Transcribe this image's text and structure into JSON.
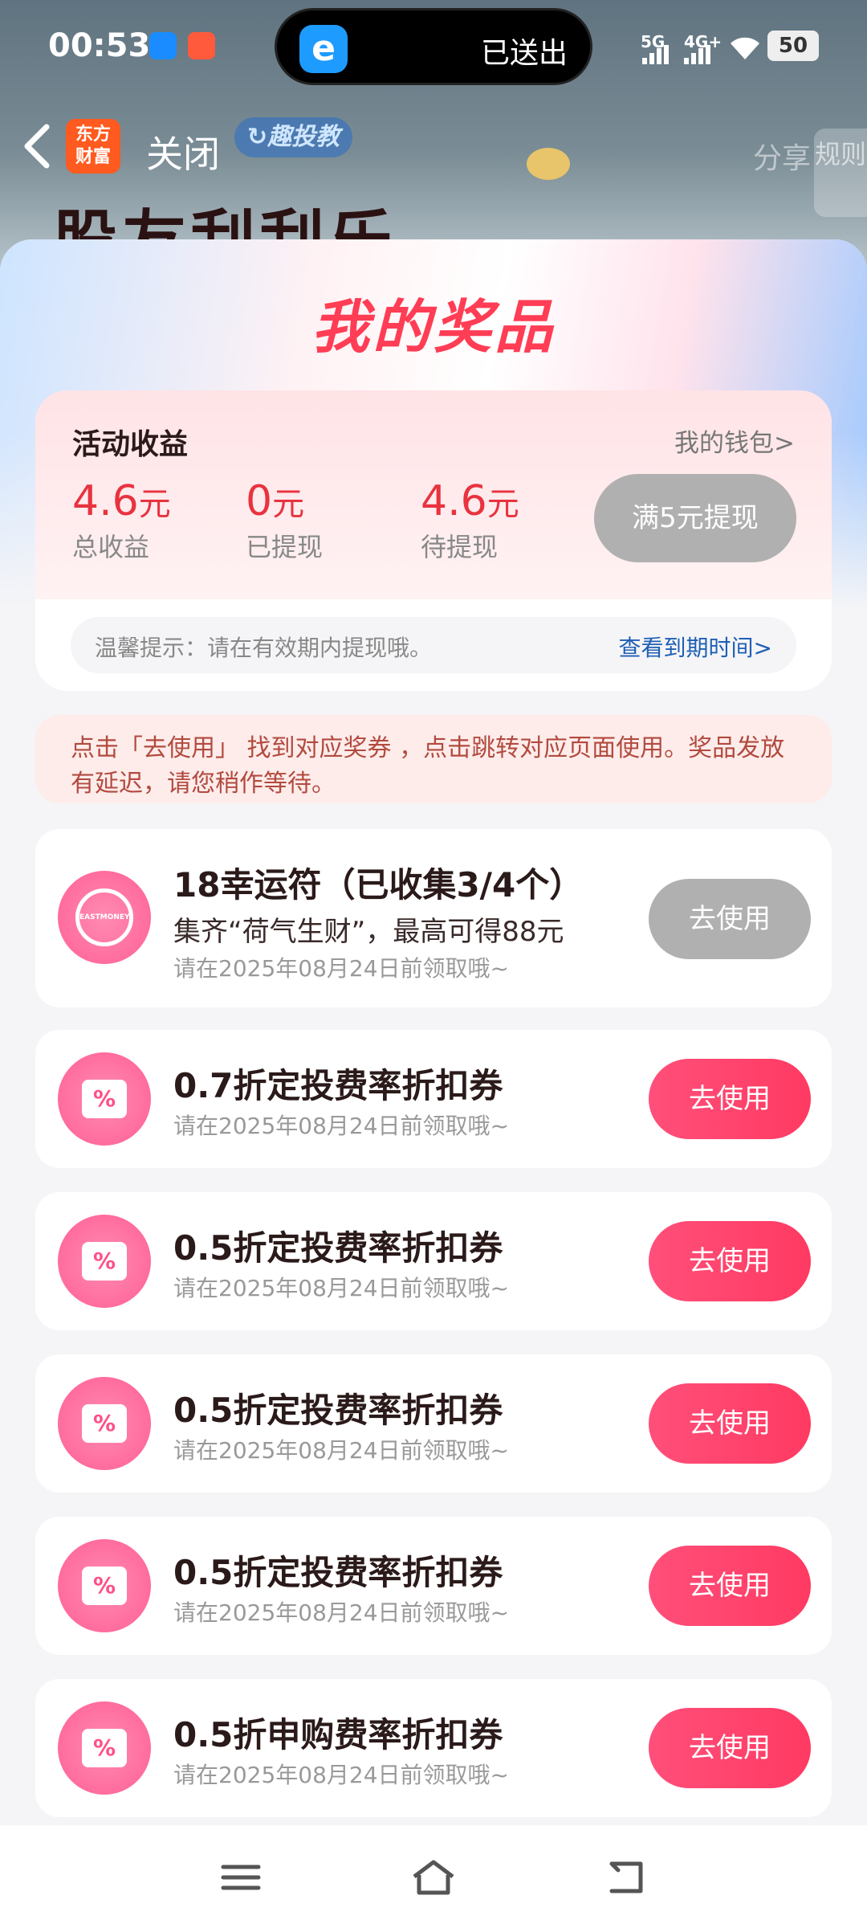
{
  "status_bar": {
    "time": "00:53",
    "island_text": "已送出",
    "island_icon_glyph": "e",
    "signal_1": "5G",
    "signal_2": "4G+",
    "battery": "50"
  },
  "nav": {
    "logo_text_line1": "东方",
    "logo_text_line2": "财富",
    "close_label": "关闭",
    "tag_label": "↻趣投教",
    "banner_text": "股友刮刮乐",
    "share_label": "分享",
    "rules_label": "规则"
  },
  "panel": {
    "title": "我的奖品"
  },
  "earnings": {
    "title": "活动收益",
    "wallet_link": "我的钱包>",
    "stats": [
      {
        "value": "4.6",
        "unit": "元",
        "label": "总收益"
      },
      {
        "value": "0",
        "unit": "元",
        "label": "已提现"
      },
      {
        "value": "4.6",
        "unit": "元",
        "label": "待提现"
      }
    ],
    "withdraw_label": "满5元提现",
    "tip_text": "温馨提示：请在有效期内提现哦。",
    "tip_link": "查看到期时间>"
  },
  "notice": "点击「去使用」 找到对应奖券 ，点击跳转对应页面使用。奖品发放有延迟，请您稍作等待。",
  "prizes": [
    {
      "title": "18幸运符（已收集3/4个）",
      "subtitle": "集齐“荷气生财”，最高可得88元",
      "date": "请在2025年08月24日前领取哦~",
      "button": "去使用",
      "enabled": false,
      "icon": "lucky-charm-icon",
      "icon_text": "EASTMONEY"
    },
    {
      "title": "0.7折定投费率折扣券",
      "date": "请在2025年08月24日前领取哦~",
      "button": "去使用",
      "enabled": true,
      "icon": "coupon-icon",
      "icon_text": "%"
    },
    {
      "title": "0.5折定投费率折扣券",
      "date": "请在2025年08月24日前领取哦~",
      "button": "去使用",
      "enabled": true,
      "icon": "coupon-icon",
      "icon_text": "%"
    },
    {
      "title": "0.5折定投费率折扣券",
      "date": "请在2025年08月24日前领取哦~",
      "button": "去使用",
      "enabled": true,
      "icon": "coupon-icon",
      "icon_text": "%"
    },
    {
      "title": "0.5折定投费率折扣券",
      "date": "请在2025年08月24日前领取哦~",
      "button": "去使用",
      "enabled": true,
      "icon": "coupon-icon",
      "icon_text": "%"
    },
    {
      "title": "0.5折申购费率折扣券",
      "date": "请在2025年08月24日前领取哦~",
      "button": "去使用",
      "enabled": true,
      "icon": "coupon-icon",
      "icon_text": "%"
    }
  ],
  "colors": {
    "accent_red": "#ff3d55",
    "amount_red": "#e8333f",
    "button_pink": "#ff3a62",
    "disabled_gray": "#b0b0b0",
    "link_blue": "#1f5fb5"
  }
}
